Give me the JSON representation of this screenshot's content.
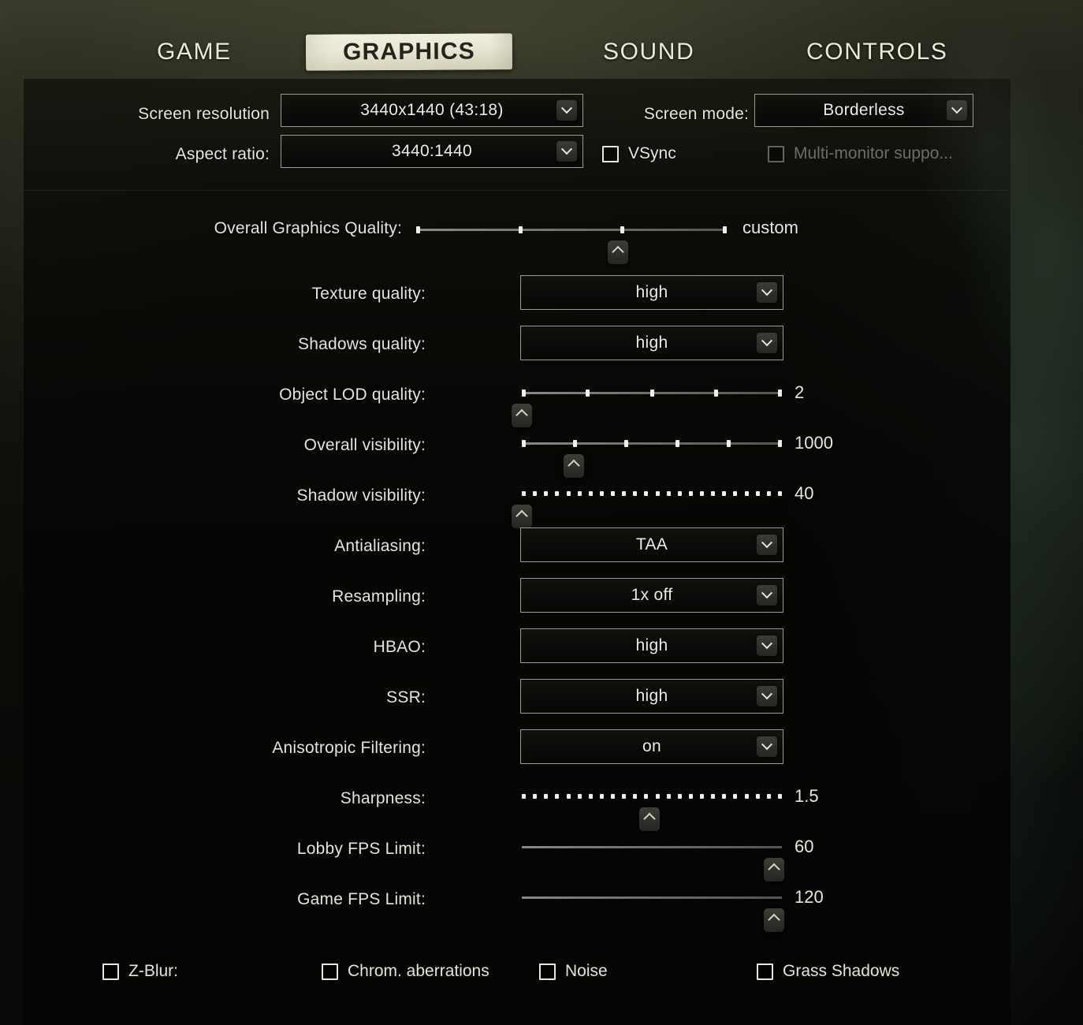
{
  "tabs": [
    {
      "label": "GAME",
      "active": false
    },
    {
      "label": "GRAPHICS",
      "active": true
    },
    {
      "label": "SOUND",
      "active": false
    },
    {
      "label": "CONTROLS",
      "active": false
    }
  ],
  "display": {
    "screen_resolution_label": "Screen resolution",
    "screen_resolution_value": "3440x1440 (43:18)",
    "aspect_ratio_label": "Aspect ratio:",
    "aspect_ratio_value": "3440:1440",
    "screen_mode_label": "Screen mode:",
    "screen_mode_value": "Borderless",
    "vsync_label": "VSync",
    "vsync_checked": false,
    "multi_monitor_label": "Multi-monitor suppo...",
    "multi_monitor_checked": false,
    "multi_monitor_disabled": true
  },
  "overall": {
    "label": "Overall Graphics Quality:",
    "value": "custom",
    "ticks": 4,
    "handle_percent": 65
  },
  "settings": [
    {
      "label": "Texture quality:",
      "type": "select",
      "value": "high"
    },
    {
      "label": "Shadows quality:",
      "type": "select",
      "value": "high"
    },
    {
      "label": "Object LOD quality:",
      "type": "slider",
      "value": "2",
      "ticks": 5,
      "handle_percent": 0,
      "dotted": false
    },
    {
      "label": "Overall visibility:",
      "type": "slider",
      "value": "1000",
      "ticks": 6,
      "handle_percent": 20,
      "dotted": false
    },
    {
      "label": "Shadow visibility:",
      "type": "slider",
      "value": "40",
      "ticks": 24,
      "handle_percent": 0,
      "dotted": true
    },
    {
      "label": "Antialiasing:",
      "type": "select",
      "value": "TAA"
    },
    {
      "label": "Resampling:",
      "type": "select",
      "value": "1x off"
    },
    {
      "label": "HBAO:",
      "type": "select",
      "value": "high"
    },
    {
      "label": "SSR:",
      "type": "select",
      "value": "high"
    },
    {
      "label": "Anisotropic Filtering:",
      "type": "select",
      "value": "on"
    },
    {
      "label": "Sharpness:",
      "type": "slider",
      "value": "1.5",
      "ticks": 24,
      "handle_percent": 49,
      "dotted": true
    },
    {
      "label": "Lobby FPS Limit:",
      "type": "slider",
      "value": "60",
      "ticks": 0,
      "handle_percent": 97,
      "dotted": false
    },
    {
      "label": "Game FPS Limit:",
      "type": "slider",
      "value": "120",
      "ticks": 0,
      "handle_percent": 97,
      "dotted": false
    }
  ],
  "toggles": [
    {
      "label": "Z-Blur:",
      "checked": false
    },
    {
      "label": "Chrom. aberrations",
      "checked": false
    },
    {
      "label": "Noise",
      "checked": false
    },
    {
      "label": "Grass Shadows",
      "checked": false
    }
  ],
  "colors": {
    "text": "#e4e6d6",
    "text_dim": "#6e7264",
    "border": "#9a9c88",
    "tab_active_bg": "#ece9d9",
    "tab_active_text": "#24241c"
  }
}
